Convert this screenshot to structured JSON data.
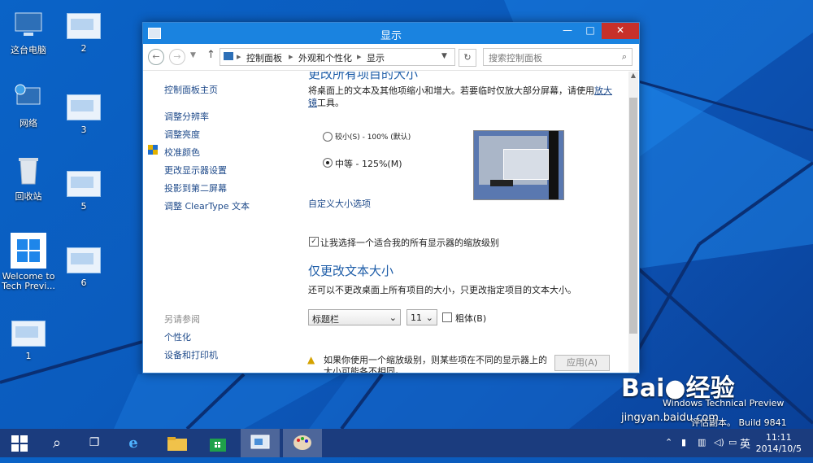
{
  "desktop": {
    "icons": [
      {
        "label": "这台电脑"
      },
      {
        "label": "网络"
      },
      {
        "label": "回收站"
      },
      {
        "label": "Welcome to Tech Previ..."
      },
      {
        "label": "1"
      },
      {
        "label": "2"
      },
      {
        "label": "3"
      },
      {
        "label": "5"
      },
      {
        "label": "6"
      }
    ]
  },
  "window": {
    "title": "显示",
    "close": "✕",
    "maximize": "□",
    "minimize": "—",
    "breadcrumb": [
      "控制面板",
      "外观和个性化",
      "显示"
    ],
    "search_placeholder": "搜索控制面板",
    "left_nav": {
      "home": "控制面板主页",
      "items": [
        "调整分辨率",
        "调整亮度",
        "校准颜色",
        "更改显示器设置",
        "投影到第二屏幕",
        "调整 ClearType 文本"
      ],
      "see_also_title": "另请参阅",
      "see_also": [
        "个性化",
        "设备和打印机"
      ]
    },
    "content": {
      "heading": "更改所有项目的大小",
      "desc_part1": "将桌面上的文本及其他项缩小和增大。若要临时仅放大部分屏幕，请使用",
      "desc_link": "放大镜",
      "desc_part2": "工具。",
      "option_small": "较小(S) - 100% (默认)",
      "option_medium": "中等 - 125%(M)",
      "custom_link": "自定义大小选项",
      "checkbox_label": "让我选择一个适合我的所有显示器的缩放级别",
      "text_heading": "仅更改文本大小",
      "text_desc": "还可以不更改桌面上所有项目的大小，只更改指定项目的文本大小。",
      "item_select": "标题栏",
      "size_select": "11",
      "bold_label": "粗体(B)",
      "warning": "如果你使用一个缩放级别，则某些项在不同的显示器上的大小可能各不相同。",
      "apply": "应用(A)"
    }
  },
  "taskbar": {
    "clock_time": "11:11",
    "clock_date": "2014/10/5",
    "ime": "英"
  },
  "watermark": {
    "brand": "Bai",
    "brand2": "经验",
    "url": "jingyan.baidu.com",
    "build1": "Windows Technical Preview",
    "build2": "评估副本。 Build 9841"
  }
}
